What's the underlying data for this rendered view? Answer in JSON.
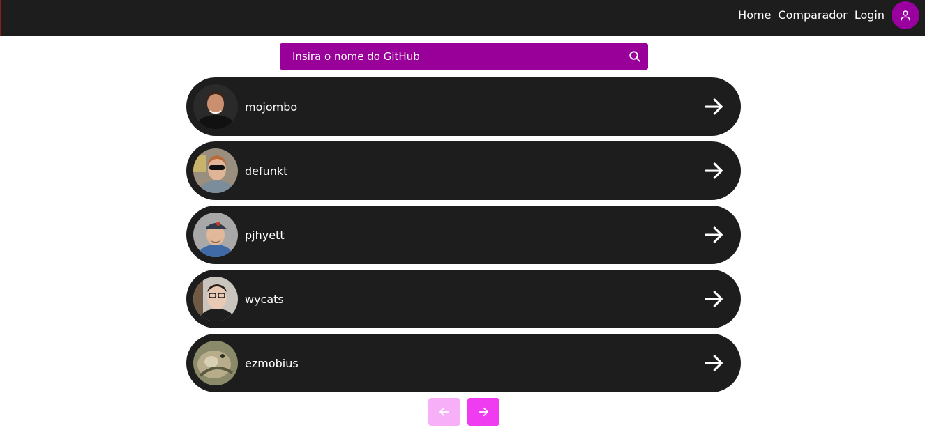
{
  "nav": {
    "links": [
      "Home",
      "Comparador",
      "Login"
    ],
    "profile_icon": "user-icon",
    "accent_color": "#9a009f"
  },
  "search": {
    "placeholder": "Insira o nome do GitHub",
    "icon": "search-icon",
    "background": "#990099"
  },
  "users": [
    {
      "login": "mojombo"
    },
    {
      "login": "defunkt"
    },
    {
      "login": "pjhyett"
    },
    {
      "login": "wycats"
    },
    {
      "login": "ezmobius"
    }
  ],
  "pagination": {
    "prev_icon": "arrow-left-icon",
    "next_icon": "arrow-right-icon",
    "prev_disabled": true
  }
}
